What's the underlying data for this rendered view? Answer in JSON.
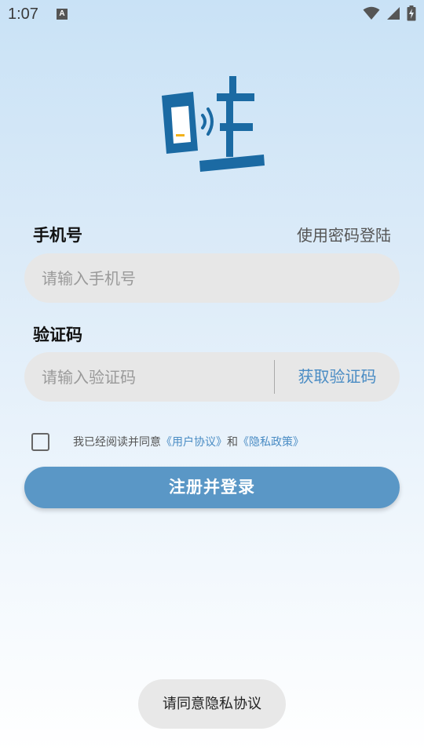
{
  "status_bar": {
    "time": "1:07",
    "notification_icon_letter": "A",
    "icons": [
      "wifi-icon",
      "signal-icon",
      "battery-charging-icon"
    ]
  },
  "logo": {
    "character": "哇",
    "brand_color": "#1b6aa3",
    "accent_color": "#f2b21b"
  },
  "form": {
    "phone_label": "手机号",
    "password_login_link": "使用密码登陆",
    "phone_placeholder": "请输入手机号",
    "phone_value": "",
    "code_label": "验证码",
    "code_placeholder": "请输入验证码",
    "code_value": "",
    "get_code_button": "获取验证码"
  },
  "agreement": {
    "checked": false,
    "prefix": "我已经阅读并同意",
    "user_agreement": "《用户协议》",
    "conjunction": "和",
    "privacy_policy": "《隐私政策》"
  },
  "submit_button": "注册并登录",
  "toast": "请同意隐私协议",
  "colors": {
    "primary_button": "#5a97c6",
    "link": "#4a8cc4",
    "input_background": "#e7e7e7"
  }
}
